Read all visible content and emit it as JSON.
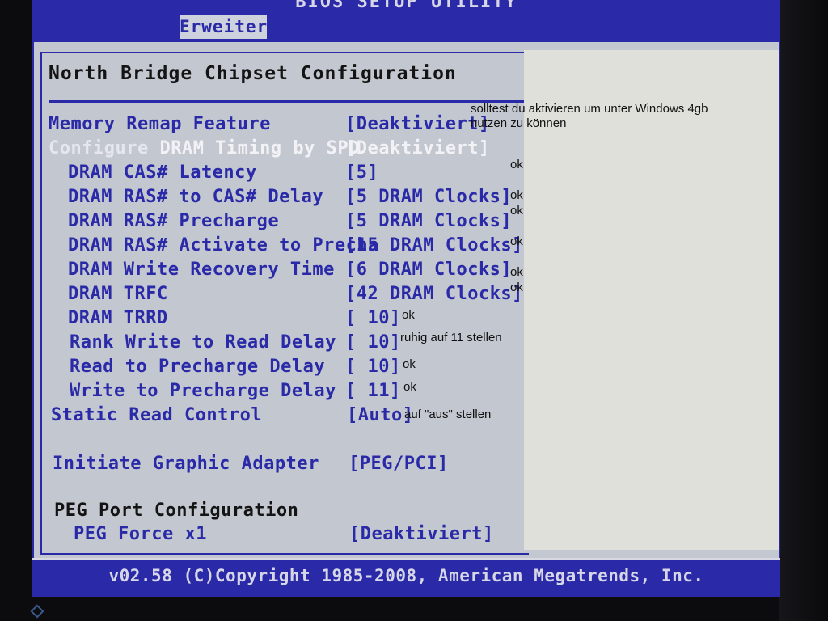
{
  "bios": {
    "title": "BIOS SETUP UTILITY",
    "active_tab": "Erweitert",
    "section_title": "North Bridge Chipset Configuration",
    "footer": "v02.58 (C)Copyright 1985-2008, American Megatrends, Inc."
  },
  "settings": [
    {
      "label": "Memory Remap Feature",
      "value": "[Deaktiviert]"
    },
    {
      "label_part1": "Configure ",
      "label_part2": "DRAM Timing by SPD",
      "value": "[Deaktiviert]"
    },
    {
      "label": "DRAM CAS# Latency",
      "value": "[5]"
    },
    {
      "label": "DRAM RAS# to CAS# Delay",
      "value": "[5 DRAM Clocks]"
    },
    {
      "label": "DRAM RAS# Precharge",
      "value": "[5 DRAM Clocks]"
    },
    {
      "label": "DRAM RAS# Activate to Precha",
      "value": "[15 DRAM Clocks]"
    },
    {
      "label": "DRAM Write Recovery Time",
      "value": "[6 DRAM Clocks]"
    },
    {
      "label": "DRAM TRFC",
      "value": "[42 DRAM Clocks]"
    },
    {
      "label": "DRAM TRRD",
      "value": "[ 10]"
    },
    {
      "label": "Rank Write to Read Delay",
      "value": "[ 10]"
    },
    {
      "label": "Read to Precharge Delay",
      "value": "[ 10]"
    },
    {
      "label": "Write to Precharge Delay",
      "value": "[ 11]"
    },
    {
      "label": "Static Read Control",
      "value": "[Auto]"
    },
    {
      "label": "Initiate Graphic Adapter",
      "value": "[PEG/PCI]"
    },
    {
      "label": "PEG Force x1",
      "value": "[Deaktiviert]"
    }
  ],
  "peg_heading": "PEG Port Configuration",
  "notes": {
    "memory_remap_line1": "solltest du aktivieren um unter Windows 4gb",
    "memory_remap_line2": "nutzen zu können",
    "cas_latency": "ok",
    "ras_to_cas": "ok",
    "ras_precharge": "ok",
    "ras_activate": "ok",
    "write_recovery": "ok",
    "trfc": "ok",
    "trrd": "ok",
    "rank_write_to_read": "ruhig auf 11 stellen",
    "read_to_precharge": "ok",
    "write_to_precharge": "ok",
    "static_read_control": "auf \"aus\" stellen"
  },
  "colors": {
    "bios_blue": "#2a2aa8",
    "panel_gray": "#c3c7cf",
    "highlight_white": "#f2f2f6",
    "note_background": "#dfe0da"
  }
}
